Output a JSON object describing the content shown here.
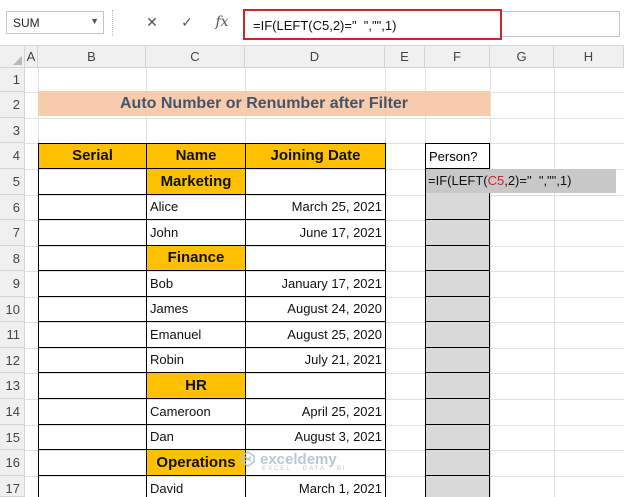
{
  "formula_bar": {
    "name_box": "SUM",
    "cancel_icon": "x-icon",
    "enter_icon": "check-icon",
    "fx_label": "fx",
    "formula": "=IF(LEFT(C5,2)=\"  \",\"\",1)"
  },
  "columns": [
    "A",
    "B",
    "C",
    "D",
    "E",
    "F",
    "G",
    "H"
  ],
  "rows": [
    "1",
    "2",
    "3",
    "4",
    "5",
    "6",
    "7",
    "8",
    "9",
    "10",
    "11",
    "12",
    "13",
    "14",
    "15",
    "16",
    "17"
  ],
  "title": "Auto Number or Renumber after Filter",
  "table": {
    "headers": [
      "Serial",
      "Name",
      "Joining Date"
    ],
    "departments": [
      "Marketing",
      "Finance",
      "HR",
      "Operations"
    ],
    "names": [
      "Alice",
      "John",
      "Bob",
      "James",
      "Emanuel",
      "Robin",
      "Cameroon",
      "Dan",
      "David"
    ],
    "dates": [
      "March 25, 2021",
      "June 17, 2021",
      "January 17, 2021",
      "August 24, 2020",
      "August 25, 2020",
      "July 21, 2021",
      "April 25, 2021",
      "August 3, 2021",
      "March 1, 2021"
    ]
  },
  "helper": {
    "header": "Person?",
    "f5_prefix": "=IF(LEFT(",
    "f5_ref": "C5",
    "f5_mid": ",2)=",
    "f5_suffix": "\"  \",\"\",1)"
  },
  "watermark": {
    "brand": "exceldemy",
    "tagline": "EXCEL · DATA · BI"
  }
}
